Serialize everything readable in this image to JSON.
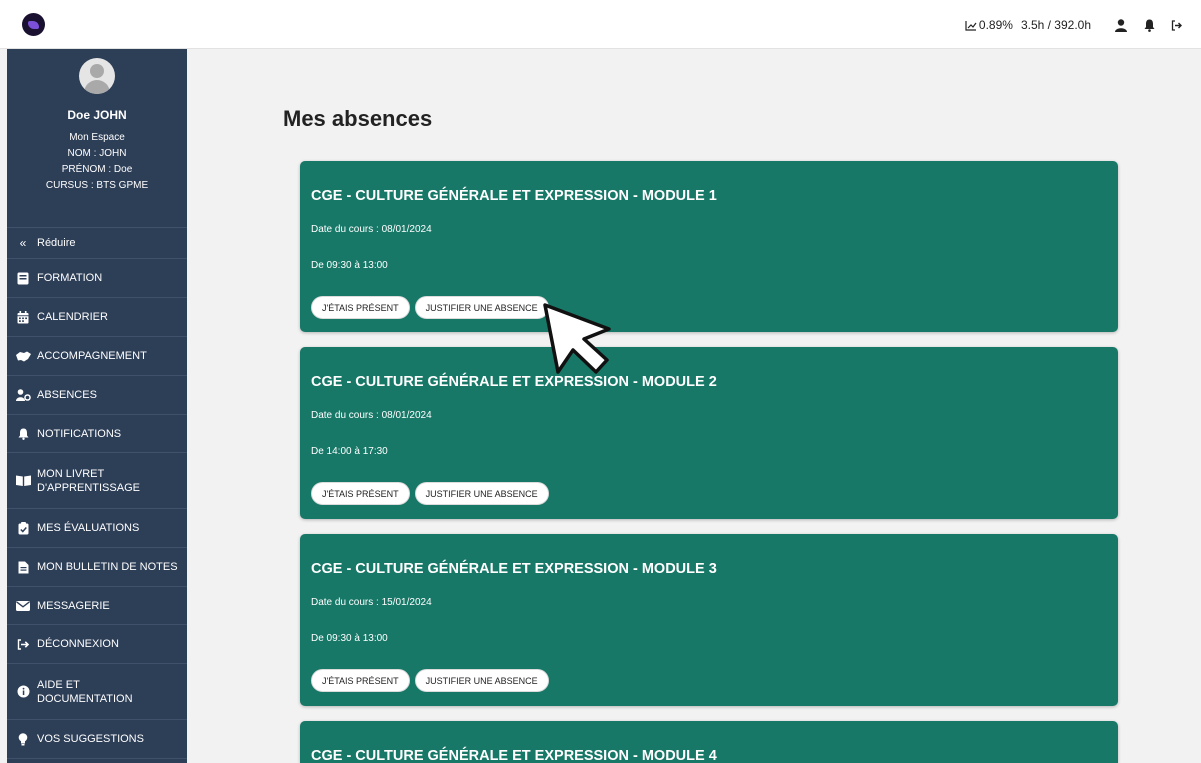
{
  "topbar": {
    "progress_text": "0.89%",
    "hours_text": "3.5h / 392.0h"
  },
  "profile": {
    "name": "Doe JOHN",
    "space_label": "Mon Espace",
    "nom": "NOM : JOHN",
    "prenom": "PRÉNOM : Doe",
    "cursus": "CURSUS : BTS GPME"
  },
  "sidebar": {
    "items": [
      {
        "label": "Réduire",
        "icon": "double-chevron-left-icon"
      },
      {
        "label": "FORMATION",
        "icon": "book-icon"
      },
      {
        "label": "CALENDRIER",
        "icon": "calendar-icon"
      },
      {
        "label": "ACCOMPAGNEMENT",
        "icon": "handshake-icon"
      },
      {
        "label": "ABSENCES",
        "icon": "user-clock-icon"
      },
      {
        "label": "NOTIFICATIONS",
        "icon": "bell-icon"
      },
      {
        "label": "MON LIVRET D'APPRENTISSAGE",
        "icon": "open-book-icon"
      },
      {
        "label": "MES ÉVALUATIONS",
        "icon": "clipboard-check-icon"
      },
      {
        "label": "MON BULLETIN DE NOTES",
        "icon": "document-icon"
      },
      {
        "label": "MESSAGERIE",
        "icon": "envelope-icon"
      },
      {
        "label": "DÉCONNEXION",
        "icon": "logout-icon"
      },
      {
        "label": "AIDE ET DOCUMENTATION",
        "icon": "info-circle-icon"
      },
      {
        "label": "VOS SUGGESTIONS",
        "icon": "lightbulb-icon"
      }
    ]
  },
  "main": {
    "title": "Mes absences",
    "present_label": "J'ÉTAIS PRÉSENT",
    "justify_label": "JUSTIFIER UNE ABSENCE",
    "cards": [
      {
        "title": "CGE - CULTURE GÉNÉRALE ET EXPRESSION - MODULE 1",
        "date": "Date du cours : 08/01/2024",
        "time": "De 09:30 à 13:00"
      },
      {
        "title": "CGE - CULTURE GÉNÉRALE ET EXPRESSION - MODULE 2",
        "date": "Date du cours : 08/01/2024",
        "time": "De 14:00 à 17:30"
      },
      {
        "title": "CGE - CULTURE GÉNÉRALE ET EXPRESSION - MODULE 3",
        "date": "Date du cours : 15/01/2024",
        "time": "De 09:30 à 13:00"
      },
      {
        "title": "CGE - CULTURE GÉNÉRALE ET EXPRESSION - MODULE 4",
        "date": "",
        "time": ""
      }
    ]
  },
  "colors": {
    "sidebar_bg": "#2d3e57",
    "card_bg": "#187868",
    "page_bg": "#f2f2f2"
  }
}
